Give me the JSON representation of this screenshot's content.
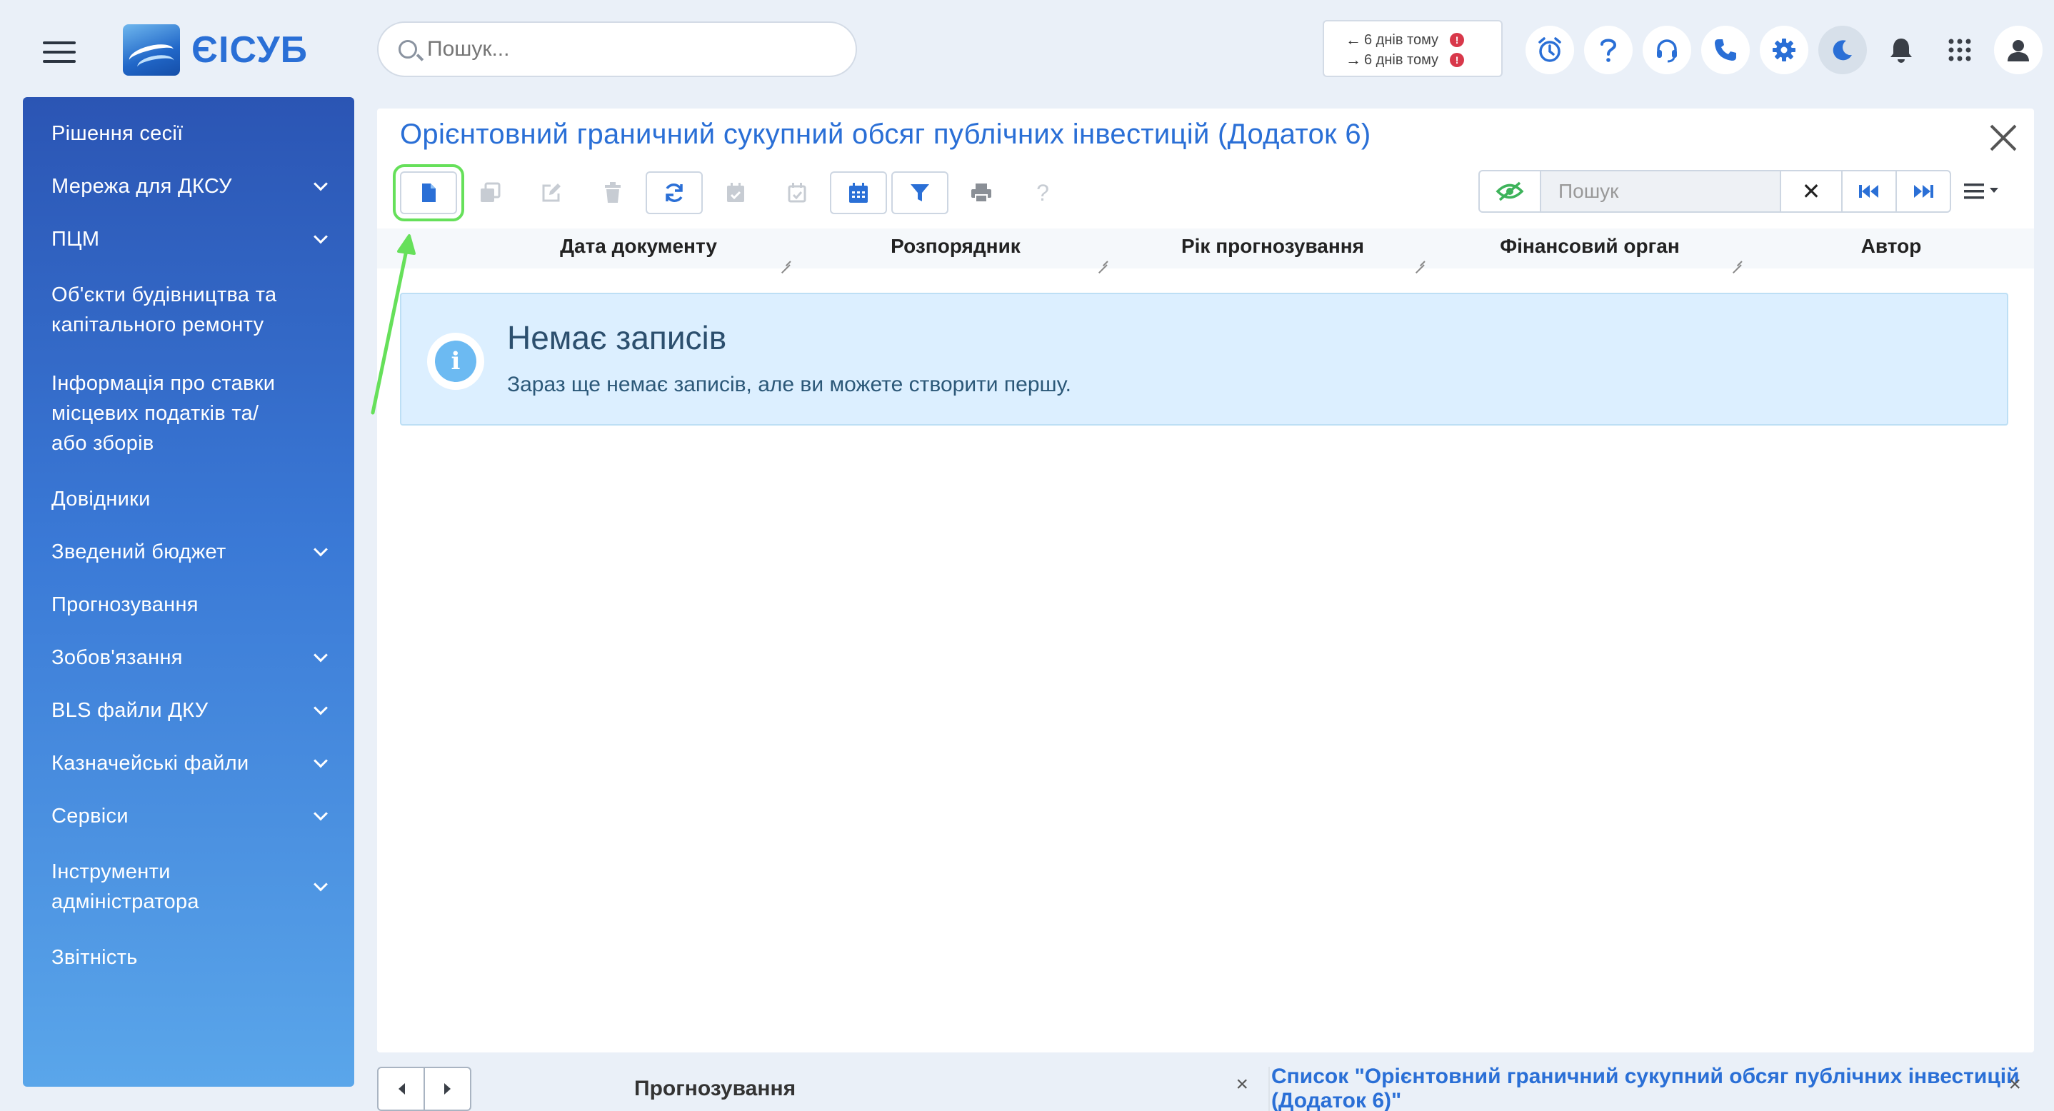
{
  "brand": {
    "name": "ЄІСУБ"
  },
  "top_search": {
    "placeholder": "Пошук..."
  },
  "history": [
    {
      "direction": "←",
      "label": "6 днів тому",
      "badge": "!"
    },
    {
      "direction": "→",
      "label": "6 днів тому",
      "badge": "!"
    }
  ],
  "sidebar": {
    "items": [
      {
        "label": "Рішення сесії"
      },
      {
        "label": "Мережа для ДКСУ"
      },
      {
        "label": "ПЦМ"
      },
      {
        "label": "Об'єкти будівництва та капітального ремонту"
      },
      {
        "label": "Інформація про ставки місцевих податків та/або зборів"
      },
      {
        "label": "Довідники"
      },
      {
        "label": "Зведений бюджет"
      },
      {
        "label": "Прогнозування"
      },
      {
        "label": "Зобов'язання"
      },
      {
        "label": "BLS файли ДКУ"
      },
      {
        "label": "Казначейські файли"
      },
      {
        "label": "Сервіси"
      },
      {
        "label": "Інструменти адміністратора"
      },
      {
        "label": "Звітність"
      }
    ]
  },
  "panel": {
    "title": "Орієнтовний граничний сукупний обсяг публічних інвестицій (Додаток 6)",
    "help_label": "?",
    "search_placeholder": "Пошук",
    "clear_label": "✕",
    "columns": [
      "Дата документу",
      "Розпорядник",
      "Рік прогнозування",
      "Фінансовий орган",
      "Автор"
    ],
    "empty_title": "Немає записів",
    "empty_text": "Зараз ще немає записів, але ви можете створити першу."
  },
  "tabs": [
    {
      "label": "Прогнозування",
      "close": "×"
    },
    {
      "label": "Список \"Орієнтовний граничний сукупний обсяг публічних інвестицій (Додаток 6)\"",
      "close": "×"
    }
  ],
  "colors": {
    "accent": "#2a6fd6",
    "highlight": "#66e05a",
    "alert_bg": "#dcefff"
  }
}
